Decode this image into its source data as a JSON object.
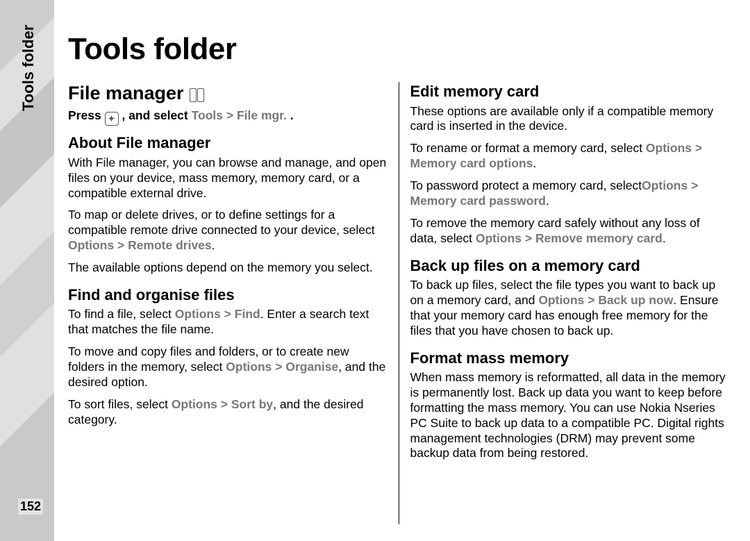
{
  "page_number": "152",
  "side_label": "Tools folder",
  "title": "Tools folder",
  "left": {
    "h2": "File manager",
    "intro": {
      "pre": "Press ",
      "post": " , and select ",
      "p1": "Tools",
      "gt": " > ",
      "p2": "File mgr.",
      "end": "."
    },
    "about_h": "About File manager",
    "about_p1": "With File manager, you can browse and manage, and open files on your device, mass memory, memory card, or a compatible external drive.",
    "about_p2": {
      "a": "To map or delete drives, or to define settings for a compatible remote drive connected to your device, select ",
      "b": "Options",
      "c": " > ",
      "d": "Remote drives",
      "e": "."
    },
    "about_p3": "The available options depend on the memory you select.",
    "find_h": "Find and organise files",
    "find_p1": {
      "a": "To find a file, select ",
      "b": "Options",
      "c": " > ",
      "d": "Find",
      "e": ". Enter a search text that matches the file name."
    },
    "find_p2": {
      "a": "To move and copy files and folders, or to create new folders in the memory, select ",
      "b": "Options",
      "c": " > ",
      "d": "Organise",
      "e": ", and the desired option."
    },
    "find_p3": {
      "a": "To sort files, select ",
      "b": "Options",
      "c": " > ",
      "d": "Sort by",
      "e": ", and the desired category."
    }
  },
  "right": {
    "edit_h": "Edit memory card",
    "edit_p1": "These options are available only if a compatible memory card is inserted in the device.",
    "edit_p2": {
      "a": "To rename or format a memory card, select ",
      "b": "Options",
      "c": " > ",
      "d": "Memory card options",
      "e": "."
    },
    "edit_p3": {
      "a": "To password protect a memory card, select",
      "b": "Options",
      "c": " > ",
      "d": "Memory card password",
      "e": "."
    },
    "edit_p4": {
      "a": "To remove the memory card safely without any loss of data, select ",
      "b": "Options",
      "c": " > ",
      "d": "Remove memory card",
      "e": "."
    },
    "backup_h": "Back up files on a memory card",
    "backup_p": {
      "a": "To back up files, select the file types you want to back up on a memory card, and ",
      "b": "Options",
      "c": " > ",
      "d": "Back up now",
      "e": ". Ensure that your memory card has enough free memory for the files that you have chosen to back up."
    },
    "format_h": "Format mass memory",
    "format_p": "When mass memory is reformatted, all data in the memory is permanently lost. Back up data you want to keep before formatting the mass memory. You can use Nokia Nseries PC Suite to back up data to a compatible PC. Digital rights management technologies (DRM) may prevent some backup data from being restored."
  }
}
